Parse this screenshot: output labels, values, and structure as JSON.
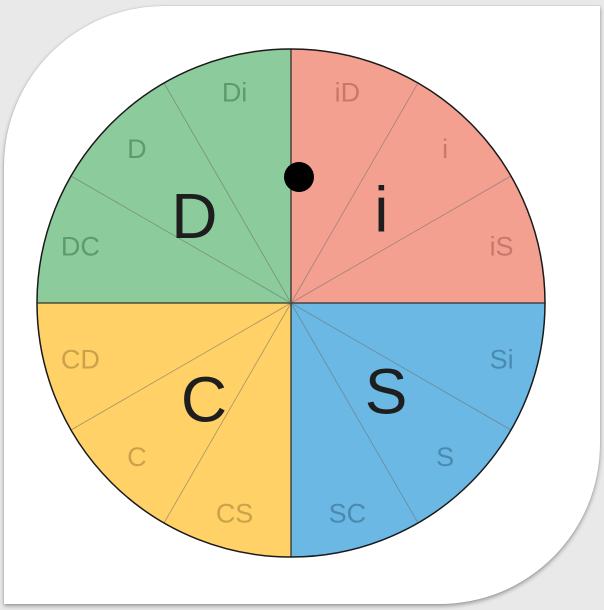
{
  "quadrants": [
    {
      "key": "D",
      "label": "D",
      "color": "#8ccb9b",
      "label_color": "#5f9a6c"
    },
    {
      "key": "i",
      "label": "i",
      "color": "#f4a090",
      "label_color": "#c8786a"
    },
    {
      "key": "S",
      "label": "S",
      "color": "#6ab8e3",
      "label_color": "#4a8ab0"
    },
    {
      "key": "C",
      "label": "C",
      "color": "#ffd166",
      "label_color": "#c9a24a"
    }
  ],
  "segments": [
    {
      "label": "Di",
      "quadrant": "D"
    },
    {
      "label": "iD",
      "quadrant": "i"
    },
    {
      "label": "i",
      "quadrant": "i"
    },
    {
      "label": "iS",
      "quadrant": "i"
    },
    {
      "label": "Si",
      "quadrant": "S"
    },
    {
      "label": "S",
      "quadrant": "S"
    },
    {
      "label": "SC",
      "quadrant": "S"
    },
    {
      "label": "CS",
      "quadrant": "C"
    },
    {
      "label": "C",
      "quadrant": "C"
    },
    {
      "label": "CD",
      "quadrant": "C"
    },
    {
      "label": "DC",
      "quadrant": "D"
    },
    {
      "label": "D",
      "quadrant": "D"
    }
  ],
  "marker": {
    "color": "#000000"
  },
  "outline_color": "#1a1a1a",
  "divider_color": "#6b6b6b"
}
